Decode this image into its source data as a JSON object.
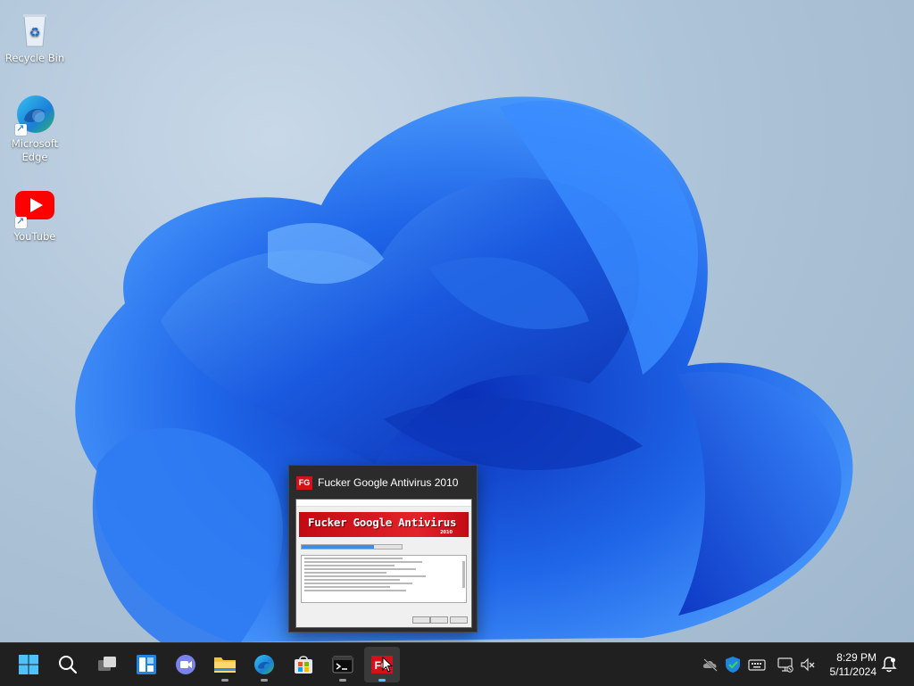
{
  "desktop": {
    "icons": [
      {
        "label": "Recycle Bin",
        "icon": "recycle-bin-icon"
      },
      {
        "label": "Microsoft Edge",
        "icon": "edge-icon"
      },
      {
        "label": "YouTube",
        "icon": "youtube-icon"
      }
    ]
  },
  "preview": {
    "title": "Fucker Google Antivirus 2010",
    "logo_text": "FG",
    "window": {
      "banner_title": "Fucker Google Antivirus",
      "banner_year": "2010",
      "progress": 0.72
    }
  },
  "taskbar": {
    "buttons": [
      {
        "name": "start-button",
        "icon": "windows-logo-icon"
      },
      {
        "name": "search-button",
        "icon": "search-icon"
      },
      {
        "name": "task-view-button",
        "icon": "task-view-icon"
      },
      {
        "name": "widgets-button",
        "icon": "widgets-icon"
      },
      {
        "name": "teams-chat-button",
        "icon": "chat-icon"
      },
      {
        "name": "file-explorer-button",
        "icon": "folder-icon"
      },
      {
        "name": "edge-button",
        "icon": "edge-icon"
      },
      {
        "name": "store-button",
        "icon": "store-icon"
      },
      {
        "name": "terminal-button",
        "icon": "terminal-icon"
      },
      {
        "name": "fg-antivirus-button",
        "icon": "fg-antivirus-icon"
      }
    ],
    "clock": {
      "time": "8:29 PM",
      "date": "5/11/2024"
    }
  },
  "colors": {
    "taskbar": "#202020",
    "accent_blue": "#1e6fd0",
    "fg_red": "#d1121b"
  }
}
